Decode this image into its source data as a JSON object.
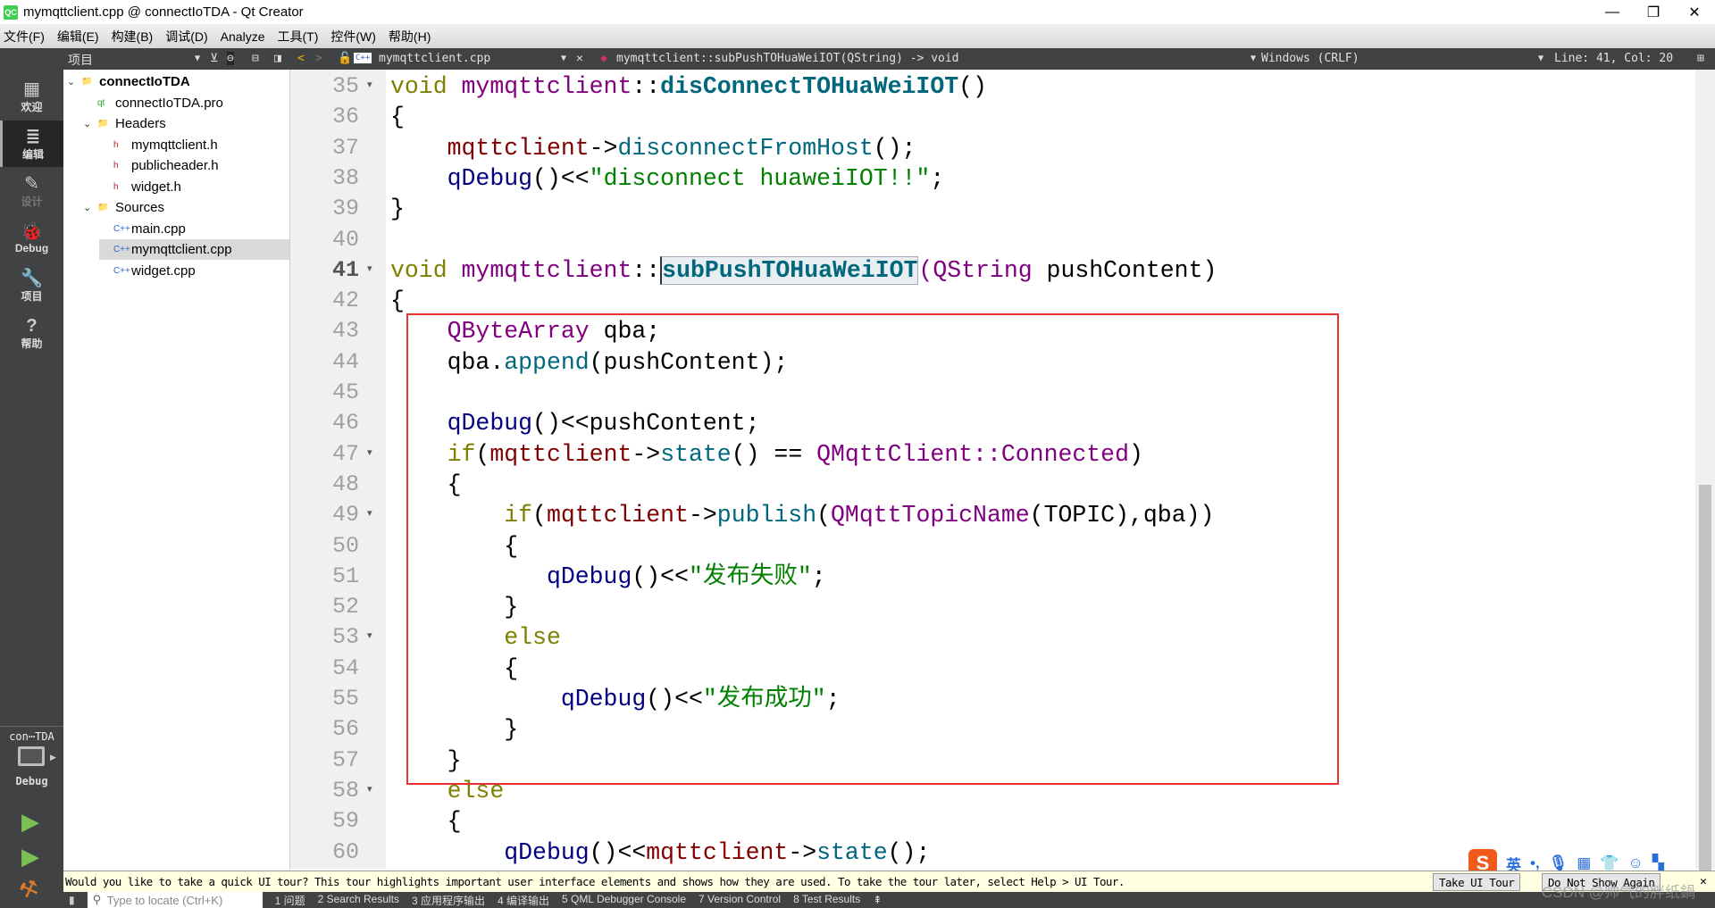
{
  "window": {
    "title": "mymqttclient.cpp @ connectIoTDA - Qt Creator",
    "logo": "QC",
    "minimize": "—",
    "restore": "❐",
    "close": "✕"
  },
  "menu": [
    "文件(F)",
    "编辑(E)",
    "构建(B)",
    "调试(D)",
    "Analyze",
    "工具(T)",
    "控件(W)",
    "帮助(H)"
  ],
  "toolbar": {
    "panel_title": "项目",
    "file": "mymqttclient.cpp",
    "symbol": "mymqttclient::subPushTOHuaWeiIOT(QString) -> void",
    "line_ending": "Windows (CRLF)",
    "position": "Line: 41, Col: 20"
  },
  "modes": [
    {
      "label": "欢迎",
      "icon": "grid-icon",
      "glyph": "▦"
    },
    {
      "label": "编辑",
      "icon": "edit-icon",
      "glyph": "≣",
      "active": true
    },
    {
      "label": "设计",
      "icon": "pencil-icon",
      "glyph": "✎",
      "disabled": true
    },
    {
      "label": "Debug",
      "icon": "bug-icon",
      "glyph": "🐞"
    },
    {
      "label": "项目",
      "icon": "wrench-icon",
      "glyph": "🔧"
    },
    {
      "label": "帮助",
      "icon": "help-icon",
      "glyph": "?"
    }
  ],
  "kit": {
    "project": "con⋯TDA",
    "config": "Debug"
  },
  "tree": [
    {
      "label": "connectIoTDA",
      "depth": 0,
      "expanded": true,
      "bold": true,
      "icon": "qt-folder"
    },
    {
      "label": "connectIoTDA.pro",
      "depth": 1,
      "icon": "pro-file"
    },
    {
      "label": "Headers",
      "depth": 1,
      "expanded": true,
      "icon": "h-folder"
    },
    {
      "label": "mymqttclient.h",
      "depth": 2,
      "icon": "h-file"
    },
    {
      "label": "publicheader.h",
      "depth": 2,
      "icon": "h-file"
    },
    {
      "label": "widget.h",
      "depth": 2,
      "icon": "h-file"
    },
    {
      "label": "Sources",
      "depth": 1,
      "expanded": true,
      "icon": "cpp-folder"
    },
    {
      "label": "main.cpp",
      "depth": 2,
      "icon": "cpp-file"
    },
    {
      "label": "mymqttclient.cpp",
      "depth": 2,
      "icon": "cpp-file",
      "selected": true
    },
    {
      "label": "widget.cpp",
      "depth": 2,
      "icon": "cpp-file"
    }
  ],
  "editor": {
    "current_line": 41,
    "folds": [
      35,
      41,
      47,
      49,
      53,
      58
    ],
    "scroll_fraction": 0.52,
    "lines": [
      {
        "n": 35,
        "t": [
          [
            "kw",
            "void "
          ],
          [
            "ty",
            "mymqttclient"
          ],
          [
            "pl",
            "::"
          ],
          [
            "fb",
            "disConnectTOHuaWeiIOT"
          ],
          [
            "pl",
            "()"
          ]
        ]
      },
      {
        "n": 36,
        "t": [
          [
            "pl",
            "{"
          ]
        ]
      },
      {
        "n": 37,
        "t": [
          [
            "pl",
            "    "
          ],
          [
            "mb",
            "mqttclient"
          ],
          [
            "pl",
            "->"
          ],
          [
            "fn",
            "disconnectFromHost"
          ],
          [
            "pl",
            "();"
          ]
        ]
      },
      {
        "n": 38,
        "t": [
          [
            "pl",
            "    "
          ],
          [
            "qd",
            "qDebug"
          ],
          [
            "pl",
            "()<<"
          ],
          [
            "st",
            "\"disconnect huaweiIOT!!\""
          ],
          [
            "pl",
            ";"
          ]
        ]
      },
      {
        "n": 39,
        "t": [
          [
            "pl",
            "}"
          ]
        ]
      },
      {
        "n": 40,
        "t": []
      },
      {
        "n": 41,
        "t": [
          [
            "kw",
            "void "
          ],
          [
            "ty",
            "mymqttclient"
          ],
          [
            "pl",
            "::"
          ],
          [
            "hl",
            "subPushTOHuaWeiIOT"
          ],
          [
            "ty",
            "(QString "
          ],
          [
            "pl",
            "pushContent)"
          ]
        ]
      },
      {
        "n": 42,
        "t": [
          [
            "pl",
            "{"
          ]
        ]
      },
      {
        "n": 43,
        "t": [
          [
            "pl",
            "    "
          ],
          [
            "ty",
            "QByteArray "
          ],
          [
            "pl",
            "qba;"
          ]
        ]
      },
      {
        "n": 44,
        "t": [
          [
            "pl",
            "    qba."
          ],
          [
            "fn",
            "append"
          ],
          [
            "pl",
            "(pushContent);"
          ]
        ]
      },
      {
        "n": 45,
        "t": []
      },
      {
        "n": 46,
        "t": [
          [
            "pl",
            "    "
          ],
          [
            "qd",
            "qDebug"
          ],
          [
            "pl",
            "()<<pushContent;"
          ]
        ]
      },
      {
        "n": 47,
        "t": [
          [
            "pl",
            "    "
          ],
          [
            "kw",
            "if"
          ],
          [
            "pl",
            "("
          ],
          [
            "mb",
            "mqttclient"
          ],
          [
            "pl",
            "->"
          ],
          [
            "fn",
            "state"
          ],
          [
            "pl",
            "() == "
          ],
          [
            "ty",
            "QMqttClient::Connected"
          ],
          [
            "pl",
            ")"
          ]
        ]
      },
      {
        "n": 48,
        "t": [
          [
            "pl",
            "    {"
          ]
        ]
      },
      {
        "n": 49,
        "t": [
          [
            "pl",
            "        "
          ],
          [
            "kw",
            "if"
          ],
          [
            "pl",
            "("
          ],
          [
            "mb",
            "mqttclient"
          ],
          [
            "pl",
            "->"
          ],
          [
            "fn",
            "publish"
          ],
          [
            "pl",
            "("
          ],
          [
            "ty",
            "QMqttTopicName"
          ],
          [
            "pl",
            "(TOPIC),qba))"
          ]
        ]
      },
      {
        "n": 50,
        "t": [
          [
            "pl",
            "        {"
          ]
        ]
      },
      {
        "n": 51,
        "t": [
          [
            "pl",
            "           "
          ],
          [
            "qd",
            "qDebug"
          ],
          [
            "pl",
            "()<<"
          ],
          [
            "st",
            "\"发布失败\""
          ],
          [
            "pl",
            ";"
          ]
        ]
      },
      {
        "n": 52,
        "t": [
          [
            "pl",
            "        }"
          ]
        ]
      },
      {
        "n": 53,
        "t": [
          [
            "pl",
            "        "
          ],
          [
            "kw",
            "else"
          ]
        ]
      },
      {
        "n": 54,
        "t": [
          [
            "pl",
            "        {"
          ]
        ]
      },
      {
        "n": 55,
        "t": [
          [
            "pl",
            "            "
          ],
          [
            "qd",
            "qDebug"
          ],
          [
            "pl",
            "()<<"
          ],
          [
            "st",
            "\"发布成功\""
          ],
          [
            "pl",
            ";"
          ]
        ]
      },
      {
        "n": 56,
        "t": [
          [
            "pl",
            "        }"
          ]
        ]
      },
      {
        "n": 57,
        "t": [
          [
            "pl",
            "    }"
          ]
        ]
      },
      {
        "n": 58,
        "t": [
          [
            "pl",
            "    "
          ],
          [
            "kw",
            "else"
          ]
        ]
      },
      {
        "n": 59,
        "t": [
          [
            "pl",
            "    {"
          ]
        ]
      },
      {
        "n": 60,
        "t": [
          [
            "pl",
            "        "
          ],
          [
            "qd",
            "qDebug"
          ],
          [
            "pl",
            "()<<"
          ],
          [
            "mb",
            "mqttclient"
          ],
          [
            "pl",
            "->"
          ],
          [
            "fn",
            "state"
          ],
          [
            "pl",
            "();"
          ]
        ]
      }
    ]
  },
  "annotation_color": "#e8312f",
  "tour": {
    "text": "Would you like to take a quick UI tour? This tour highlights important user interface elements and shows how they are used. To take the tour later, select Help > UI Tour.",
    "take": "Take UI Tour",
    "dismiss": "Do Not Show Again",
    "close": "✕"
  },
  "output": {
    "locate_placeholder": "Type to locate (Ctrl+K)",
    "panes": [
      "1 问题",
      "2 Search Results",
      "3 应用程序输出",
      "4 编译输出",
      "5 QML Debugger Console",
      "7 Version Control",
      "8 Test Results"
    ]
  },
  "ime": {
    "lang": "英"
  },
  "watermark": "CSDN @帅气的胖纸鍋"
}
